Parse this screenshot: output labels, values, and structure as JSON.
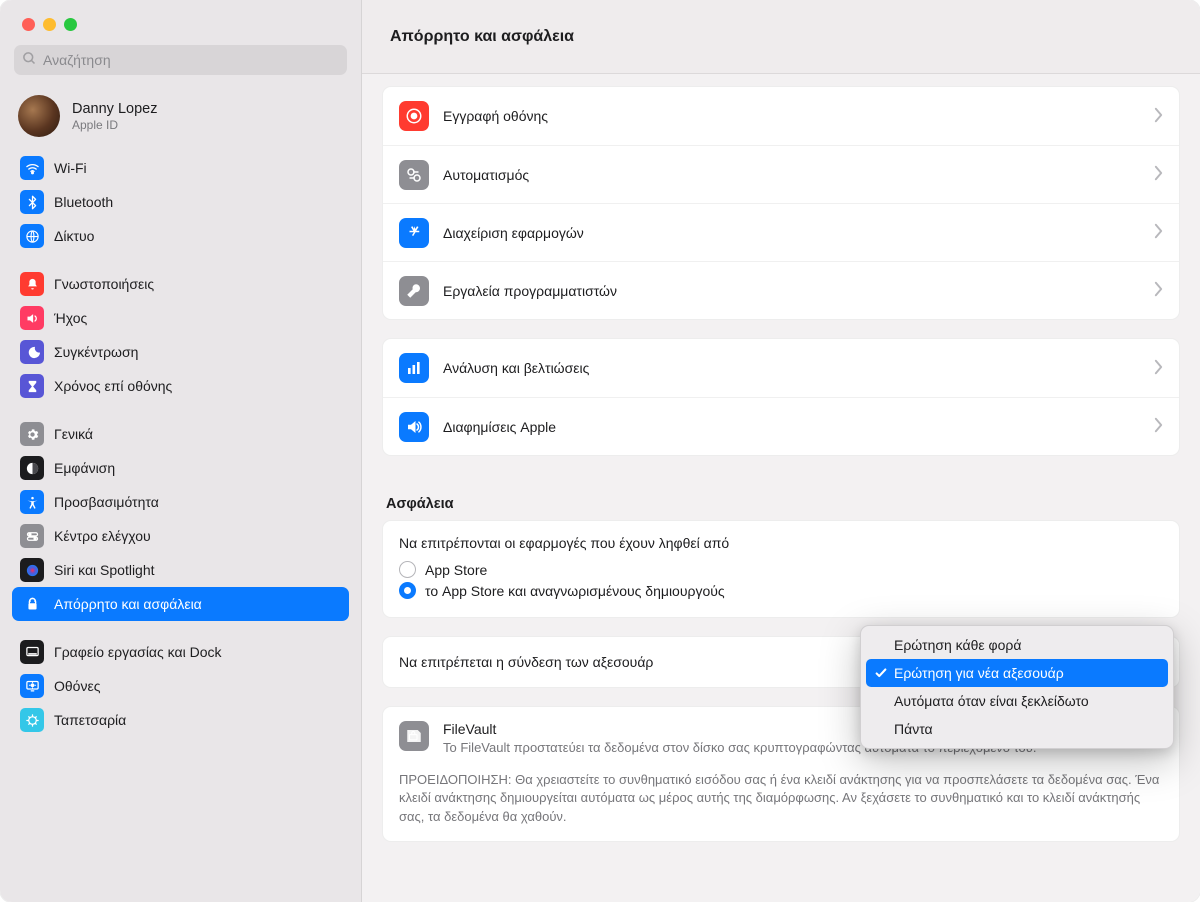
{
  "search": {
    "placeholder": "Αναζήτηση"
  },
  "account": {
    "name": "Danny Lopez",
    "sub": "Apple ID"
  },
  "sidebar": {
    "groups": [
      {
        "items": [
          {
            "label": "Wi-Fi",
            "icon": "wifi",
            "bg": "#0a7aff"
          },
          {
            "label": "Bluetooth",
            "icon": "bluetooth",
            "bg": "#0a7aff"
          },
          {
            "label": "Δίκτυο",
            "icon": "network",
            "bg": "#0a7aff"
          }
        ]
      },
      {
        "items": [
          {
            "label": "Γνωστοποιήσεις",
            "icon": "bell",
            "bg": "#ff3b30"
          },
          {
            "label": "Ήχος",
            "icon": "sound",
            "bg": "#ff3b63"
          },
          {
            "label": "Συγκέντρωση",
            "icon": "focus",
            "bg": "#5856d6"
          },
          {
            "label": "Χρόνος επί οθόνης",
            "icon": "hourglass",
            "bg": "#5856d6"
          }
        ]
      },
      {
        "items": [
          {
            "label": "Γενικά",
            "icon": "gear",
            "bg": "#8e8e93"
          },
          {
            "label": "Εμφάνιση",
            "icon": "appearance",
            "bg": "#1c1c1e"
          },
          {
            "label": "Προσβασιμότητα",
            "icon": "accessibility",
            "bg": "#0a7aff"
          },
          {
            "label": "Κέντρο ελέγχου",
            "icon": "controlcenter",
            "bg": "#8e8e93"
          },
          {
            "label": "Siri και Spotlight",
            "icon": "siri",
            "bg": "#1c1c1e"
          },
          {
            "label": "Απόρρητο και ασφάλεια",
            "icon": "privacy",
            "bg": "#0a7aff",
            "active": true
          }
        ]
      },
      {
        "items": [
          {
            "label": "Γραφείο εργασίας και Dock",
            "icon": "dock",
            "bg": "#1c1c1e"
          },
          {
            "label": "Οθόνες",
            "icon": "displays",
            "bg": "#0a7aff"
          },
          {
            "label": "Ταπετσαρία",
            "icon": "wallpaper",
            "bg": "#34c7e8"
          }
        ]
      }
    ]
  },
  "page_title": "Απόρρητο και ασφάλεια",
  "privacy_rows_1": [
    {
      "label": "Εγγραφή οθόνης",
      "icon": "record",
      "bg": "#ff3b30"
    },
    {
      "label": "Αυτοματισμός",
      "icon": "automation",
      "bg": "#8e8e93"
    },
    {
      "label": "Διαχείριση εφαρμογών",
      "icon": "appstore",
      "bg": "#0a7aff"
    },
    {
      "label": "Εργαλεία προγραμματιστών",
      "icon": "devtools",
      "bg": "#8e8e93"
    }
  ],
  "privacy_rows_2": [
    {
      "label": "Ανάλυση και βελτιώσεις",
      "icon": "analytics",
      "bg": "#0a7aff"
    },
    {
      "label": "Διαφημίσεις Apple",
      "icon": "ads",
      "bg": "#0a7aff"
    }
  ],
  "security": {
    "title": "Ασφάλεια",
    "allow_apps_title": "Να επιτρέπονται οι εφαρμογές που έχουν ληφθεί από",
    "radio_options": [
      {
        "label": "App Store",
        "checked": false
      },
      {
        "label": "το App Store και αναγνωρισμένους δημιουργούς",
        "checked": true
      }
    ],
    "accessories_label": "Να επιτρέπεται η σύνδεση των αξεσουάρ",
    "dropdown_options": [
      {
        "label": "Ερώτηση κάθε φορά",
        "selected": false
      },
      {
        "label": "Ερώτηση για νέα αξεσουάρ",
        "selected": true
      },
      {
        "label": "Αυτόματα όταν είναι ξεκλείδωτο",
        "selected": false
      },
      {
        "label": "Πάντα",
        "selected": false
      }
    ],
    "filevault": {
      "title": "FileVault",
      "desc": "Το FileVault προστατεύει τα δεδομένα στον δίσκο σας κρυπτογραφώντας αυτόματα το περιεχόμενό του.",
      "warning": "ΠΡΟΕΙΔΟΠΟΙΗΣΗ: Θα χρειαστείτε το συνθηματικό εισόδου σας ή ένα κλειδί ανάκτησης για να προσπελάσετε τα δεδομένα σας. Ένα κλειδί ανάκτησης δημιουργείται αυτόματα ως μέρος αυτής της διαμόρφωσης. Αν ξεχάσετε το συνθηματικό και το κλειδί ανάκτησής σας, τα δεδομένα θα χαθούν."
    }
  }
}
